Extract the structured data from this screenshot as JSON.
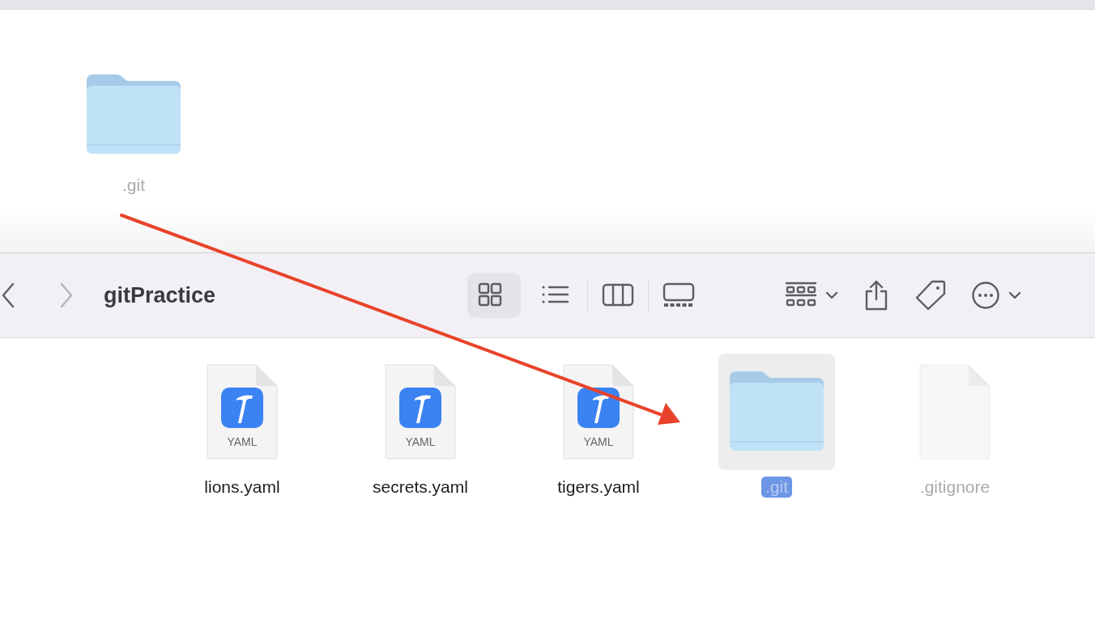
{
  "top_pane": {
    "items": [
      {
        "name": ".git",
        "kind": "folder",
        "hidden": true,
        "selected": false
      }
    ]
  },
  "toolbar": {
    "nav": [
      {
        "kind": "back",
        "disabled": false
      },
      {
        "kind": "forward",
        "disabled": true
      }
    ],
    "title": "gitPractice",
    "view_modes": [
      {
        "kind": "icons",
        "selected": true
      },
      {
        "kind": "list",
        "selected": false
      },
      {
        "kind": "columns",
        "selected": false
      },
      {
        "kind": "gallery",
        "selected": false
      }
    ],
    "actions": [
      {
        "kind": "group"
      },
      {
        "kind": "share"
      },
      {
        "kind": "tag"
      },
      {
        "kind": "more"
      }
    ]
  },
  "files": [
    {
      "name": "lions.yaml",
      "kind": "yaml",
      "badge": "YAML",
      "hidden": false,
      "selected": false
    },
    {
      "name": "secrets.yaml",
      "kind": "yaml",
      "badge": "YAML",
      "hidden": false,
      "selected": false
    },
    {
      "name": "tigers.yaml",
      "kind": "yaml",
      "badge": "YAML",
      "hidden": false,
      "selected": false
    },
    {
      "name": ".git",
      "kind": "folder",
      "hidden": true,
      "selected": true
    },
    {
      "name": ".gitignore",
      "kind": "plain",
      "hidden": true,
      "selected": false
    }
  ],
  "annotations": [
    {
      "kind": "arrow"
    }
  ]
}
